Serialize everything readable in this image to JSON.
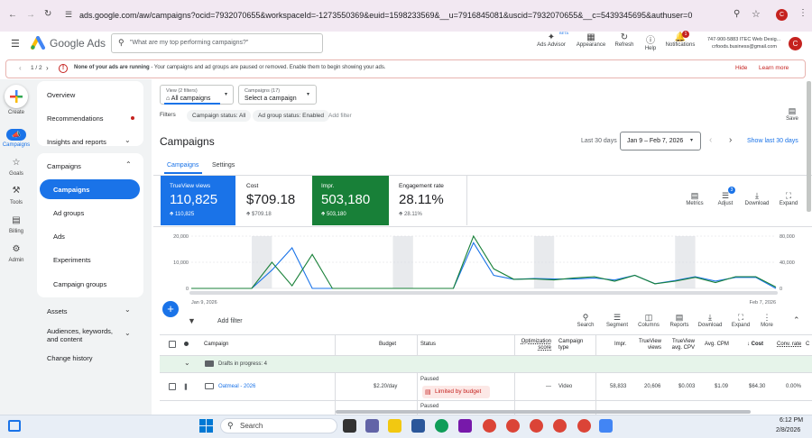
{
  "browser": {
    "url": "ads.google.com/aw/campaigns?ocid=7932070655&workspaceId=-1273550369&euid=1598233569&__u=7916845081&uscid=7932070655&__c=5439345695&authuser=0",
    "profile_initial": "C"
  },
  "header": {
    "app_name": "Google Ads",
    "search_placeholder": "\"What are my top performing campaigns?\"",
    "ads_advisor": "Ads Advisor",
    "beta": "BETA",
    "appearance": "Appearance",
    "refresh": "Refresh",
    "help": "Help",
    "notifications": "Notifications",
    "notif_count": "1",
    "account_line1": "747-900-5883 ITEC Web Desig...",
    "account_line2": "crfoods.business@gmail.com",
    "avatar_initial": "C"
  },
  "warning": {
    "pager": "1 / 2",
    "bold": "None of your ads are running",
    "text": " - Your campaigns and ad groups are paused or removed. Enable them to begin showing your ads.",
    "hide": "Hide",
    "learn_more": "Learn more"
  },
  "rail": {
    "create": "Create",
    "campaigns": "Campaigns",
    "goals": "Goals",
    "tools": "Tools",
    "billing": "Billing",
    "admin": "Admin"
  },
  "nav": {
    "overview": "Overview",
    "recommendations": "Recommendations",
    "insights": "Insights and reports",
    "campaigns": "Campaigns",
    "campaigns_sub": "Campaigns",
    "ad_groups": "Ad groups",
    "ads": "Ads",
    "experiments": "Experiments",
    "campaign_groups": "Campaign groups",
    "assets": "Assets",
    "audiences": "Audiences, keywords, and content",
    "change_history": "Change history"
  },
  "filters": {
    "view_label": "View (2 filters)",
    "view_value": "All campaigns",
    "campaigns_label": "Campaigns (17)",
    "campaigns_value": "Select a campaign",
    "filters_label": "Filters",
    "chip1": "Campaign status: All",
    "chip2": "Ad group status: Enabled",
    "add_filter": "Add filter",
    "save": "Save"
  },
  "page": {
    "title": "Campaigns",
    "range_label": "Last 30 days",
    "range_value": "Jan 9 – Feb 7, 2026",
    "show_last": "Show last 30 days",
    "tab_campaigns": "Campaigns",
    "tab_settings": "Settings"
  },
  "metrics": [
    {
      "label": "TrueView views",
      "value": "110,825",
      "delta": "110,825",
      "bg": "#1a73e8",
      "fg": "#ffffff"
    },
    {
      "label": "Cost",
      "value": "$709.18",
      "delta": "$709.18",
      "bg": "#ffffff",
      "fg": "#202124"
    },
    {
      "label": "Impr.",
      "value": "503,180",
      "delta": "503,180",
      "bg": "#188038",
      "fg": "#ffffff"
    },
    {
      "label": "Engagement rate",
      "value": "28.11%",
      "delta": "28.11%",
      "bg": "#ffffff",
      "fg": "#202124"
    }
  ],
  "chart_tools": {
    "metrics": "Metrics",
    "adjust": "Adjust",
    "adjust_badge": "3",
    "download": "Download",
    "expand": "Expand"
  },
  "chart_data": {
    "type": "line",
    "x_start_label": "Jan 9, 2026",
    "x_end_label": "Feb 7, 2026",
    "left_ticks": [
      "20,000",
      "10,000",
      "0"
    ],
    "right_ticks": [
      "80,000",
      "40,000",
      "0"
    ],
    "ylim_left": [
      0,
      20000
    ],
    "ylim_right": [
      0,
      80000
    ],
    "series": [
      {
        "color": "#1a73e8",
        "axis": "left",
        "values": [
          0,
          0,
          0,
          0,
          7000,
          15500,
          0,
          0,
          0,
          0,
          0,
          0,
          0,
          0,
          17500,
          5000,
          3500,
          3800,
          3600,
          3600,
          4000,
          3200,
          5000,
          1800,
          3000,
          4500,
          2800,
          4200,
          4200,
          0
        ]
      },
      {
        "color": "#188038",
        "axis": "right",
        "values": [
          0,
          0,
          0,
          0,
          40000,
          4000,
          52000,
          0,
          0,
          0,
          0,
          0,
          0,
          0,
          80000,
          30000,
          14000,
          14500,
          13000,
          16000,
          18000,
          11000,
          20000,
          7000,
          11000,
          17000,
          9000,
          18000,
          18000,
          2000
        ]
      }
    ],
    "weekend_bands": [
      [
        3,
        4
      ],
      [
        10,
        11
      ],
      [
        17,
        18
      ],
      [
        24,
        25
      ]
    ],
    "colors": {
      "blue": "#1a73e8",
      "green": "#188038"
    }
  },
  "table_tools": {
    "add_filter": "Add filter",
    "search": "Search",
    "segment": "Segment",
    "columns": "Columns",
    "reports": "Reports",
    "download": "Download",
    "expand": "Expand",
    "more": "More"
  },
  "table": {
    "headers": {
      "campaign": "Campaign",
      "budget": "Budget",
      "status": "Status",
      "optimization": "Optimization score",
      "type": "Campaign type",
      "impr": "Impr.",
      "views": "TrueView views",
      "cpv": "TrueView avg. CPV",
      "cpm": "Avg. CPM",
      "cost": "Cost",
      "conv": "Conv. rate",
      "c": "C"
    },
    "drafts": "Drafts in progress: 4",
    "row": {
      "name": "Oatmeal - 2026",
      "budget": "$2.20/day",
      "status": "Paused",
      "limited": "Limited by budget",
      "opt": "—",
      "type": "Video",
      "impr": "58,833",
      "views": "20,606",
      "cpv": "$0.003",
      "cpm": "$1.09",
      "cost": "$64.30",
      "conv": "0.00%"
    },
    "row2_status": "Paused"
  },
  "taskbar": {
    "search": "Search",
    "time": "6:12 PM",
    "date": "2/8/2026"
  }
}
